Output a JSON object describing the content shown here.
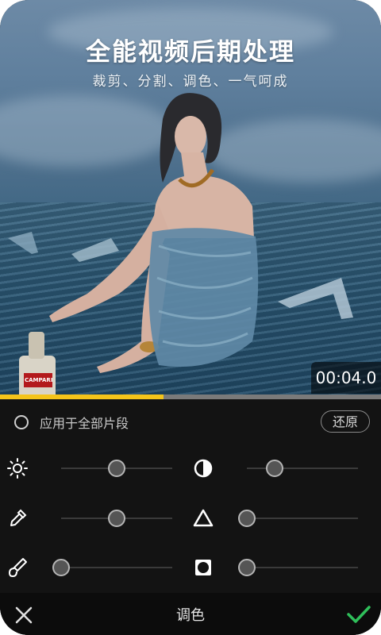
{
  "preview": {
    "title": "全能视频后期处理",
    "subtitle": "裁剪、分割、调色、一气呵成",
    "timestamp": "00:04.0",
    "progress_percent": 43,
    "bottle_label": "CAMPARI"
  },
  "panel": {
    "apply_all_label": "应用于全部片段",
    "apply_all_checked": false,
    "reset_label": "还原",
    "controls": [
      {
        "icon": "brightness-icon",
        "value_percent": 50
      },
      {
        "icon": "contrast-icon",
        "value_percent": 25
      },
      {
        "icon": "eyedropper-icon",
        "value_percent": 50
      },
      {
        "icon": "triangle-icon",
        "value_percent": 0
      },
      {
        "icon": "brush-icon",
        "value_percent": 0
      },
      {
        "icon": "vignette-icon",
        "value_percent": 0
      }
    ]
  },
  "bottom_bar": {
    "title": "调色",
    "close_icon": "close-icon",
    "confirm_icon": "check-icon"
  },
  "colors": {
    "accent_progress": "#f4c41a",
    "confirm_green": "#2fbf5a",
    "panel_bg": "#131313"
  }
}
